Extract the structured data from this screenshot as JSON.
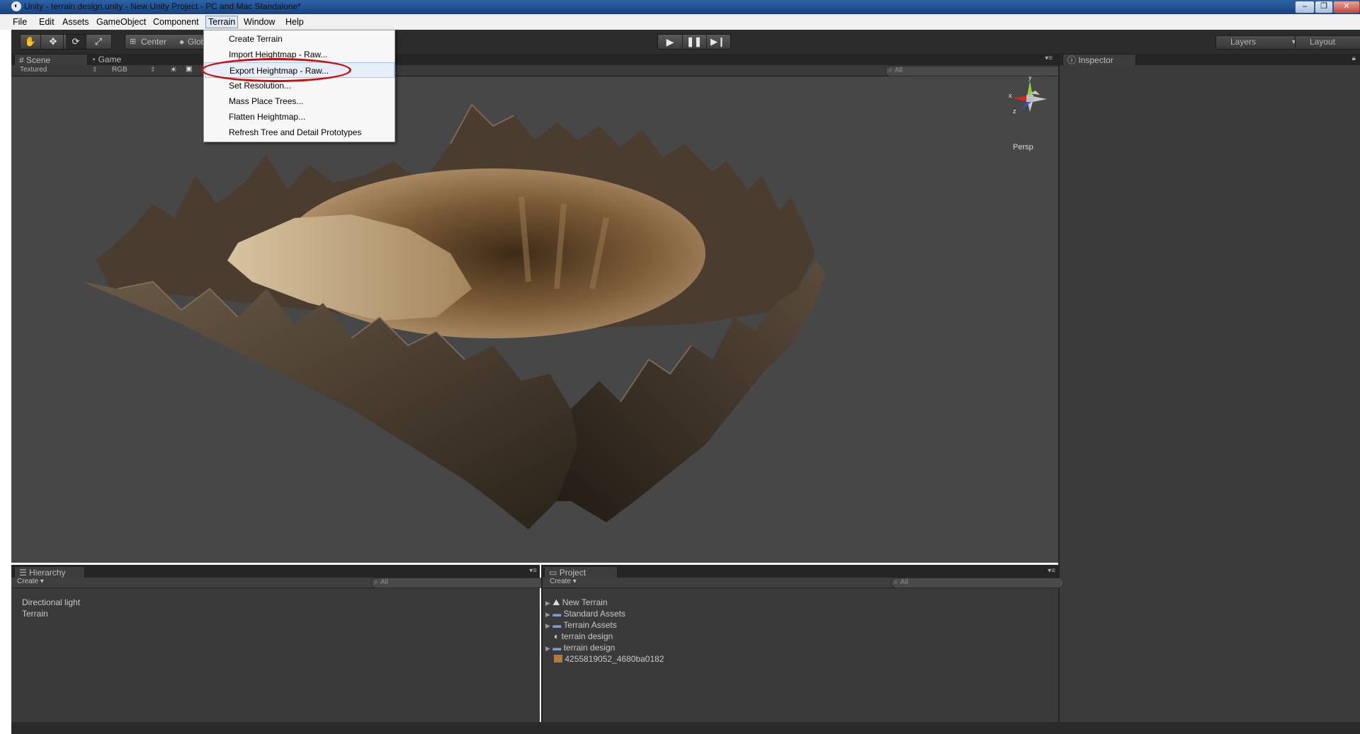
{
  "window": {
    "title": "Unity - terrain design.unity - New Unity Project - PC and Mac Standalone*",
    "buttons": [
      "–",
      "❐",
      "✕"
    ]
  },
  "menubar": {
    "items": [
      "File",
      "Edit",
      "Assets",
      "GameObject",
      "Component",
      "Terrain",
      "Window",
      "Help"
    ],
    "active": "Terrain"
  },
  "terrain_menu": {
    "items": [
      "Create Terrain",
      "Import Heightmap - Raw...",
      "Export Heightmap - Raw...",
      "Set Resolution...",
      "Mass Place Trees...",
      "Flatten Heightmap...",
      "Refresh Tree and Detail Prototypes"
    ],
    "highlighted_index": 2
  },
  "toolbar": {
    "pivot_label": "Center",
    "global_label": "Glob",
    "layers_label": "Layers",
    "layout_label": "Layout"
  },
  "scene": {
    "tabs": [
      "Scene",
      "Game"
    ],
    "render_mode": "Textured",
    "color_mode": "RGB",
    "search_placeholder": "All",
    "camera_label": "Persp",
    "gizmo_axes": [
      "y",
      "x",
      "z"
    ]
  },
  "inspector": {
    "tab": "Inspector"
  },
  "hierarchy": {
    "tab": "Hierarchy",
    "create_label": "Create ▾",
    "search_placeholder": "All",
    "items": [
      "Directional light",
      "Terrain"
    ]
  },
  "project": {
    "tab": "Project",
    "create_label": "Create ▾",
    "search_placeholder": "All",
    "items": [
      {
        "label": "New Terrain",
        "icon": "terrain-icon",
        "expandable": true
      },
      {
        "label": "Standard Assets",
        "icon": "folder-icon",
        "expandable": true
      },
      {
        "label": "Terrain Assets",
        "icon": "folder-icon",
        "expandable": true
      },
      {
        "label": "terrain design",
        "icon": "unity-scene-icon",
        "expandable": false
      },
      {
        "label": "terrain design",
        "icon": "folder-icon",
        "expandable": true
      },
      {
        "label": "4255819052_4680ba0182",
        "icon": "texture-icon",
        "expandable": false
      }
    ]
  },
  "colors": {
    "menu_highlight_ring": "#c80f12",
    "panel_bg": "#3a3a3a",
    "scene_bg": "#474747",
    "folder": "#7d9dc9",
    "texture": "#b07a3a"
  }
}
